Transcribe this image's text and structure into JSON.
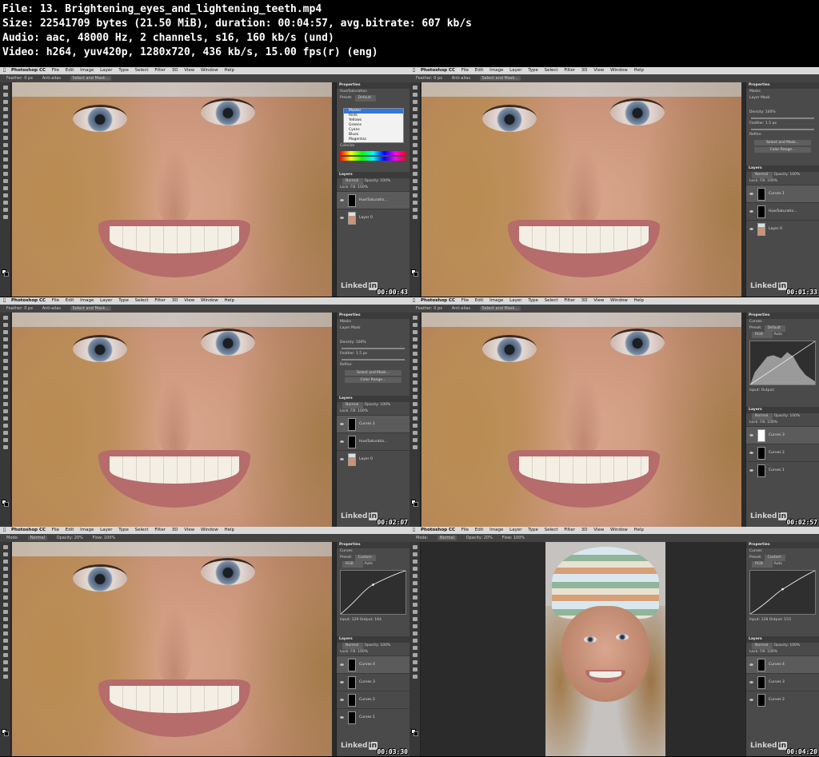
{
  "info": {
    "file_line": "File: 13. Brightening_eyes_and_lightening_teeth.mp4",
    "size_line": "Size: 22541709 bytes (21.50 MiB), duration: 00:04:57, avg.bitrate: 607 kb/s",
    "audio_line": "Audio: aac, 48000 Hz, 2 channels, s16, 160 kb/s (und)",
    "video_line": "Video: h264, yuv420p, 1280x720, 436 kb/s, 15.00 fps(r) (eng)"
  },
  "menu": [
    "Photoshop CC",
    "File",
    "Edit",
    "Image",
    "Layer",
    "Type",
    "Select",
    "Filter",
    "3D",
    "View",
    "Window",
    "Help"
  ],
  "watermark": "Linked",
  "watermark_in": "in",
  "frames": [
    {
      "timestamp": "00:00:43",
      "options": [
        "Feather: 0 px",
        "Anti-alias",
        "Select and Mask..."
      ],
      "panel_title": "Properties",
      "panel_sub": "Hue/Saturation",
      "preset_label": "Preset:",
      "preset_value": "Default",
      "dropdown_items": [
        "Master",
        "Reds",
        "Yellows",
        "Greens",
        "Cyans",
        "Blues",
        "Magentas"
      ],
      "colorize_label": "Colorize",
      "layers_title": "Layers",
      "blend": "Normal",
      "opacity": "Opacity: 100%",
      "lock": "Lock:",
      "fill": "Fill: 100%",
      "layers": [
        "Hue/Saturatio...",
        "Layer 0"
      ]
    },
    {
      "timestamp": "00:01:33",
      "options": [
        "Feather: 0 px",
        "Anti-alias",
        "Select and Mask..."
      ],
      "panel_title": "Properties",
      "panel_sub": "Masks",
      "layer_mask": "Layer Mask",
      "density": "Density:",
      "density_val": "100%",
      "feather": "Feather:",
      "feather_val": "1.5 px",
      "refine": "Refine:",
      "select_mask": "Select and Mask...",
      "color_range": "Color Range...",
      "layers_title": "Layers",
      "blend": "Normal",
      "opacity": "Opacity: 100%",
      "lock": "Lock:",
      "fill": "Fill: 100%",
      "layers": [
        "Curves 1",
        "Hue/Saturatio...",
        "Layer 0"
      ]
    },
    {
      "timestamp": "00:02:07",
      "options": [
        "Feather: 0 px",
        "Anti-alias",
        "Select and Mask..."
      ],
      "panel_title": "Properties",
      "panel_sub": "Masks",
      "layer_mask": "Layer Mask",
      "density": "Density:",
      "density_val": "100%",
      "feather": "Feather:",
      "feather_val": "1.5 px",
      "refine": "Refine:",
      "select_mask": "Select and Mask...",
      "color_range": "Color Range...",
      "layers_title": "Layers",
      "blend": "Normal",
      "opacity": "Opacity: 100%",
      "lock": "Lock:",
      "fill": "Fill: 100%",
      "layers": [
        "Curves 1",
        "Hue/Saturatio...",
        "Layer 0"
      ]
    },
    {
      "timestamp": "00:02:57",
      "options": [
        "Feather: 0 px",
        "Anti-alias",
        "Select and Mask..."
      ],
      "panel_title": "Properties",
      "panel_sub": "Curves",
      "preset_label": "Preset:",
      "preset_value": "Default",
      "channel": "RGB",
      "auto": "Auto",
      "input": "Input:",
      "output": "Output:",
      "layers_title": "Layers",
      "blend": "Normal",
      "opacity": "Opacity: 100%",
      "lock": "Lock:",
      "fill": "Fill: 100%",
      "layers": [
        "Curves 3",
        "Curves 2",
        "Curves 1"
      ]
    },
    {
      "timestamp": "00:03:30",
      "options": [
        "Mode:",
        "Normal",
        "Opacity: 20%",
        "Flow: 100%"
      ],
      "panel_title": "Properties",
      "panel_sub": "Curves",
      "preset_label": "Preset:",
      "preset_value": "Custom",
      "channel": "RGB",
      "auto": "Auto",
      "input": "Input: 129",
      "output": "Output: 164",
      "layers_title": "Layers",
      "blend": "Normal",
      "opacity": "Opacity: 100%",
      "lock": "Lock:",
      "fill": "Fill: 100%",
      "layers": [
        "Curves 4",
        "Curves 3",
        "Curves 2",
        "Curves 1"
      ]
    },
    {
      "timestamp": "00:04:20",
      "options": [
        "Mode:",
        "Normal",
        "Opacity: 20%",
        "Flow: 100%"
      ],
      "panel_title": "Properties",
      "panel_sub": "Curves",
      "preset_label": "Preset:",
      "preset_value": "Custom",
      "channel": "RGB",
      "auto": "Auto",
      "input": "Input: 128",
      "output": "Output: 153",
      "layers_title": "Layers",
      "blend": "Normal",
      "opacity": "Opacity: 100%",
      "lock": "Lock:",
      "fill": "Fill: 100%",
      "layers": [
        "Curves 4",
        "Curves 3",
        "Curves 2"
      ]
    }
  ]
}
